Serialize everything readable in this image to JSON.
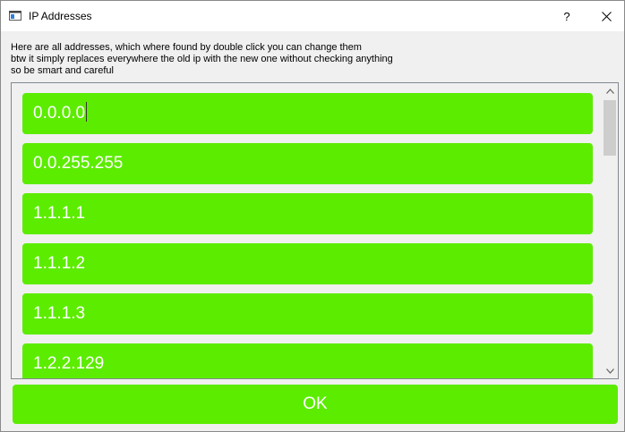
{
  "window": {
    "title": "IP Addresses",
    "help_label": "?",
    "close_label": "✕"
  },
  "description": {
    "line1": "Here are all addresses, which where found by double click you can change them",
    "line2": "btw it simply replaces everywhere the old ip with the new one without checking anything",
    "line3": "so be smart and careful"
  },
  "ip_list": {
    "items": [
      {
        "value": "0.0.0.0"
      },
      {
        "value": "0.0.255.255"
      },
      {
        "value": "1.1.1.1"
      },
      {
        "value": "1.1.1.2"
      },
      {
        "value": "1.1.1.3"
      },
      {
        "value": "1.2.2.129"
      }
    ],
    "scroll_up_icon": "▲",
    "scroll_down_icon": "▼"
  },
  "ok_button": {
    "label": "OK"
  },
  "colors": {
    "item_green": "#5cec00",
    "text_white": "#ffffff"
  }
}
